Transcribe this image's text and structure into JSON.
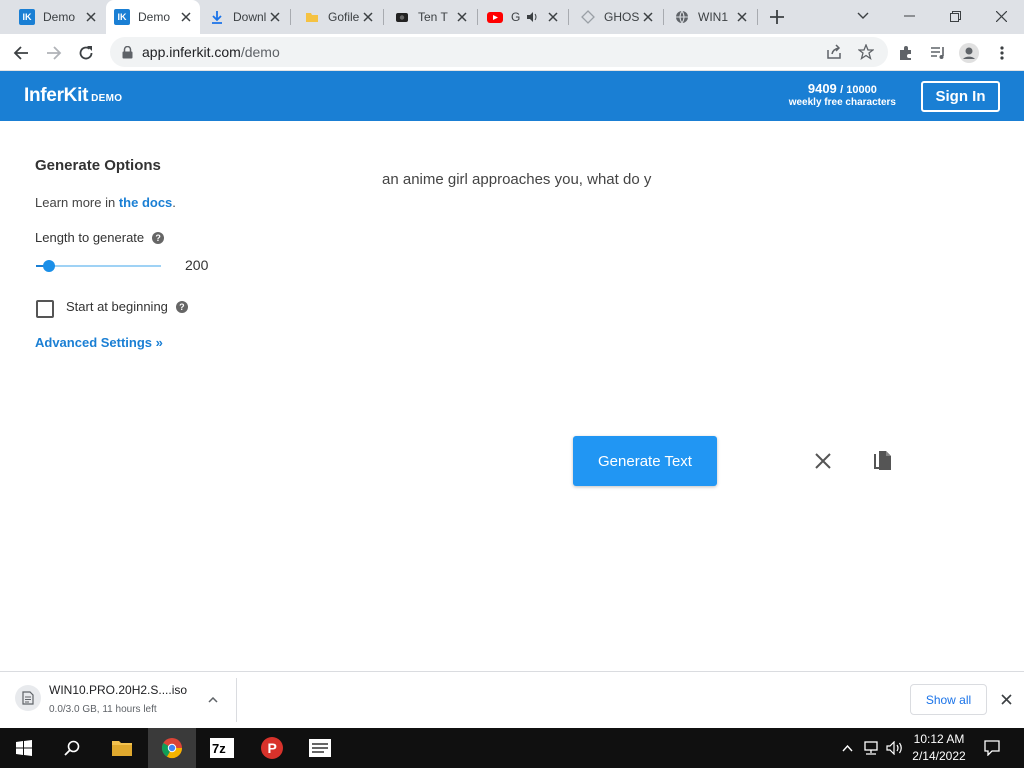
{
  "browser": {
    "tabs": [
      {
        "title": "Demo",
        "favicon": "inferkit-icon",
        "active": false
      },
      {
        "title": "Demo",
        "favicon": "inferkit-icon",
        "active": true
      },
      {
        "title": "Downl",
        "favicon": "download-icon",
        "active": false
      },
      {
        "title": "Gofile",
        "favicon": "gofile-icon",
        "active": false
      },
      {
        "title": "Ten T",
        "favicon": "video-icon",
        "active": false
      },
      {
        "title": "G",
        "favicon": "youtube-icon",
        "active": false,
        "audio": true
      },
      {
        "title": "GHOS",
        "favicon": "ghost-icon",
        "active": false
      },
      {
        "title": "WIN1",
        "favicon": "globe-icon",
        "active": false
      }
    ],
    "url_host": "app.inferkit.com",
    "url_path": "/demo"
  },
  "header": {
    "brand": "InferKit",
    "brand_tag": "DEMO",
    "quota_used": "9409",
    "quota_total": "/ 10000",
    "quota_label": "weekly free characters",
    "signin_label": "Sign In"
  },
  "options": {
    "title": "Generate Options",
    "learn_prefix": "Learn more in ",
    "docs_link": "the docs",
    "learn_suffix": ".",
    "length_label": "Length to generate",
    "length_value": "200",
    "length_fraction": 0.1,
    "start_label": "Start at beginning",
    "start_checked": false,
    "advanced_label": "Advanced Settings »"
  },
  "editor": {
    "prompt_text": "an anime girl approaches you, what do y",
    "generate_label": "Generate Text"
  },
  "downloads": {
    "file_name": "WIN10.PRO.20H2.S....iso",
    "status": "0.0/3.0 GB, 11 hours left",
    "show_all": "Show all"
  },
  "taskbar": {
    "time": "10:12 AM",
    "date": "2/14/2022"
  },
  "colors": {
    "brand_blue": "#1a7fd4",
    "button_blue": "#2196f3"
  }
}
